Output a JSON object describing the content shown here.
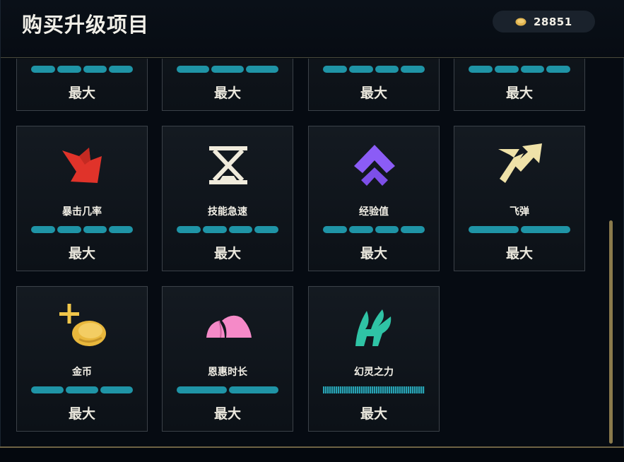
{
  "header": {
    "title": "购买升级项目",
    "currency_icon": "coin-icon",
    "currency_amount": "28851"
  },
  "colors": {
    "progress": "#1f94a6",
    "scrollbar": "#8a7a4c"
  },
  "upgrades": [
    {
      "name": "",
      "icon": "partial-icon",
      "status": "最大",
      "segments": 4
    },
    {
      "name": "",
      "icon": "partial-icon",
      "status": "最大",
      "segments": 3
    },
    {
      "name": "",
      "icon": "partial-icon",
      "status": "最大",
      "segments": 4
    },
    {
      "name": "",
      "icon": "partial-icon",
      "status": "最大",
      "segments": 4
    },
    {
      "name": "暴击几率",
      "icon": "critical-strike-icon",
      "status": "最大",
      "segments": 4
    },
    {
      "name": "技能急速",
      "icon": "hourglass-icon",
      "status": "最大",
      "segments": 4
    },
    {
      "name": "经验值",
      "icon": "chevron-up-icon",
      "status": "最大",
      "segments": 4
    },
    {
      "name": "飞弹",
      "icon": "projectile-arrow-icon",
      "status": "最大",
      "segments": 2
    },
    {
      "name": "金币",
      "icon": "gold-plus-icon",
      "status": "最大",
      "segments": 3
    },
    {
      "name": "恩惠时长",
      "icon": "boon-duration-icon",
      "status": "最大",
      "segments": 2
    },
    {
      "name": "幻灵之力",
      "icon": "spirit-power-icon",
      "status": "最大",
      "segments": "many"
    }
  ]
}
